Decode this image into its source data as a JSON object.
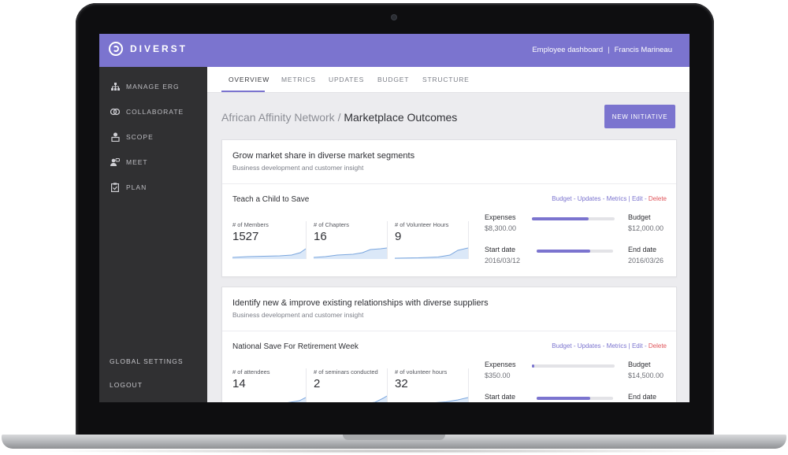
{
  "header": {
    "brand": "DIVERST",
    "nav_dashboard": "Employee dashboard",
    "nav_separator": "|",
    "nav_user": "Francis Marineau"
  },
  "sidebar": {
    "items": [
      {
        "label": "MANAGE ERG",
        "icon": "org-chart-icon"
      },
      {
        "label": "COLLABORATE",
        "icon": "collaborate-icon"
      },
      {
        "label": "SCOPE",
        "icon": "scope-icon"
      },
      {
        "label": "MEET",
        "icon": "meet-icon"
      },
      {
        "label": "PLAN",
        "icon": "clipboard-icon"
      }
    ],
    "global_settings": "GLOBAL SETTINGS",
    "logout": "LOGOUT"
  },
  "tabs": [
    "OVERVIEW",
    "METRICS",
    "UPDATES",
    "BUDGET",
    "STRUCTURE"
  ],
  "active_tab": "OVERVIEW",
  "page": {
    "breadcrumb_parent": "African Affinity Network /",
    "breadcrumb_current": "Marketplace Outcomes",
    "new_initiative": "NEW INITIATIVE"
  },
  "links": {
    "budget": "Budget",
    "updates": "Updates",
    "metrics": "Metrics",
    "edit": "Edit",
    "delete": "Delete",
    "dash": " - ",
    "bar": " | "
  },
  "finance_labels": {
    "expenses": "Expenses",
    "budget": "Budget",
    "start": "Start date",
    "end": "End date"
  },
  "outcomes": [
    {
      "title": "Grow market share in diverse market segments",
      "subtitle": "Business development and customer insight",
      "initiative": "Teach a Child to Save",
      "metrics": [
        {
          "label": "# of Members",
          "value": "1527"
        },
        {
          "label": "# of Chapters",
          "value": "16"
        },
        {
          "label": "# of Volunteer Hours",
          "value": "9"
        }
      ],
      "expenses": "$8,300.00",
      "budget": "$12,000.00",
      "expense_ratio": 0.69,
      "start_date": "2016/03/12",
      "end_date": "2016/03/26",
      "time_ratio": 0.7
    },
    {
      "title": "Identify new & improve existing relationships with diverse suppliers",
      "subtitle": "Business development and customer insight",
      "initiative": "National Save For Retirement Week",
      "metrics": [
        {
          "label": "# of attendees",
          "value": "14"
        },
        {
          "label": "# of seminars conducted",
          "value": "2"
        },
        {
          "label": "# of volunteer hours",
          "value": "32"
        }
      ],
      "expenses": "$350.00",
      "budget": "$14,500.00",
      "expense_ratio": 0.024,
      "start_date": "",
      "end_date": "",
      "time_ratio": 0.7
    }
  ],
  "colors": {
    "accent": "#7b74cf",
    "sidebar": "#303032",
    "delete": "#e0555b"
  }
}
